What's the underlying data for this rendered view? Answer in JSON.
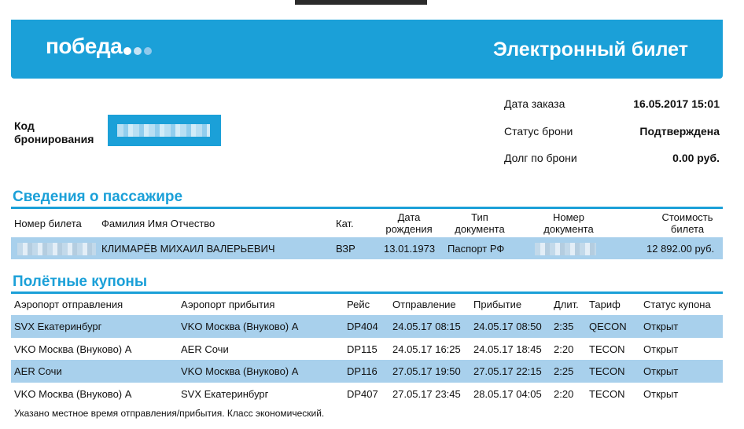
{
  "header": {
    "logo_text": "победа",
    "logo_dot_colors": [
      "#ffffff",
      "#c5e3f5",
      "#8fc9ec"
    ],
    "title": "Электронный билет",
    "brand_color": "#1ba0d8"
  },
  "booking": {
    "code_label": "Код бронирования",
    "order_date_label": "Дата заказа",
    "order_date_value": "16.05.2017 15:01",
    "status_label": "Статус брони",
    "status_value": "Подтверждена",
    "debt_label": "Долг по брони",
    "debt_value": "0.00 руб."
  },
  "passenger": {
    "section_title": "Сведения о пассажире",
    "columns": {
      "ticket": "Номер билета",
      "name": "Фамилия Имя Отчество",
      "cat": "Кат.",
      "dob": "Дата рождения",
      "doc_type": "Тип документа",
      "doc_num": "Номер документа",
      "cost": "Стоимость билета"
    },
    "row": {
      "name": "КЛИМАРЁВ МИХАИЛ ВАЛЕРЬЕВИЧ",
      "cat": "ВЗР",
      "dob": "13.01.1973",
      "doc_type": "Паспорт РФ",
      "cost": "12 892.00 руб."
    }
  },
  "coupons": {
    "section_title": "Полётные купоны",
    "columns": {
      "from": "Аэропорт отправления",
      "to": "Аэропорт прибытия",
      "flight": "Рейс",
      "dep": "Отправление",
      "arr": "Прибытие",
      "dur": "Длит.",
      "fare": "Тариф",
      "status": "Статус купона"
    },
    "rows": [
      {
        "from": "SVX Екатеринбург",
        "to": "VKO Москва (Внуково) A",
        "flight": "DP404",
        "dep": "24.05.17 08:15",
        "arr": "24.05.17 08:50",
        "dur": "2:35",
        "fare": "QECON",
        "status": "Открыт"
      },
      {
        "from": "VKO Москва (Внуково) A",
        "to": "AER Сочи",
        "flight": "DP115",
        "dep": "24.05.17 16:25",
        "arr": "24.05.17 18:45",
        "dur": "2:20",
        "fare": "TECON",
        "status": "Открыт"
      },
      {
        "from": "AER Сочи",
        "to": "VKO Москва (Внуково) A",
        "flight": "DP116",
        "dep": "27.05.17 19:50",
        "arr": "27.05.17 22:15",
        "dur": "2:25",
        "fare": "TECON",
        "status": "Открыт"
      },
      {
        "from": "VKO Москва (Внуково) A",
        "to": "SVX Екатеринбург",
        "flight": "DP407",
        "dep": "27.05.17 23:45",
        "arr": "28.05.17 04:05",
        "dur": "2:20",
        "fare": "TECON",
        "status": "Открыт"
      }
    ],
    "note": "Указано местное время отправления/прибытия. Класс экономический."
  }
}
